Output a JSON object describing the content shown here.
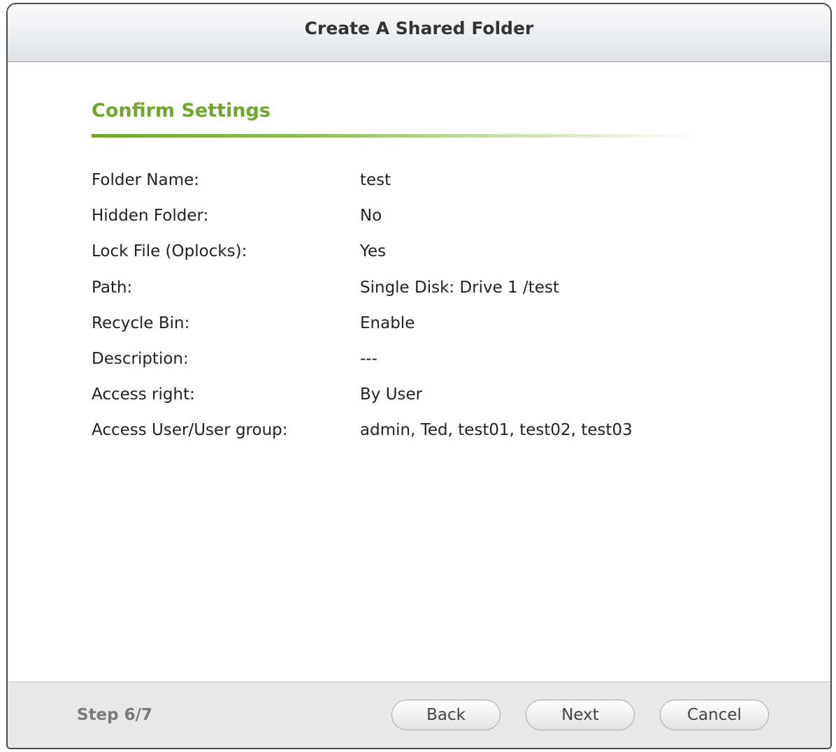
{
  "dialog": {
    "title": "Create A Shared Folder"
  },
  "section": {
    "title": "Confirm Settings"
  },
  "settings": [
    {
      "label": "Folder Name:",
      "value": "test"
    },
    {
      "label": "Hidden Folder:",
      "value": "No"
    },
    {
      "label": "Lock File (Oplocks):",
      "value": "Yes"
    },
    {
      "label": "Path:",
      "value": "Single Disk: Drive 1 /test"
    },
    {
      "label": "Recycle Bin:",
      "value": "Enable"
    },
    {
      "label": "Description:",
      "value": "---"
    },
    {
      "label": "Access right:",
      "value": "By User"
    },
    {
      "label": "Access User/User group:",
      "value": "admin, Ted, test01, test02, test03"
    }
  ],
  "footer": {
    "step": "Step 6/7",
    "back_label": "Back",
    "next_label": "Next",
    "cancel_label": "Cancel"
  },
  "colors": {
    "accent_green": "#6da82a",
    "title_bar": "#e4e7ea",
    "footer_bg": "#e8e8e8"
  }
}
